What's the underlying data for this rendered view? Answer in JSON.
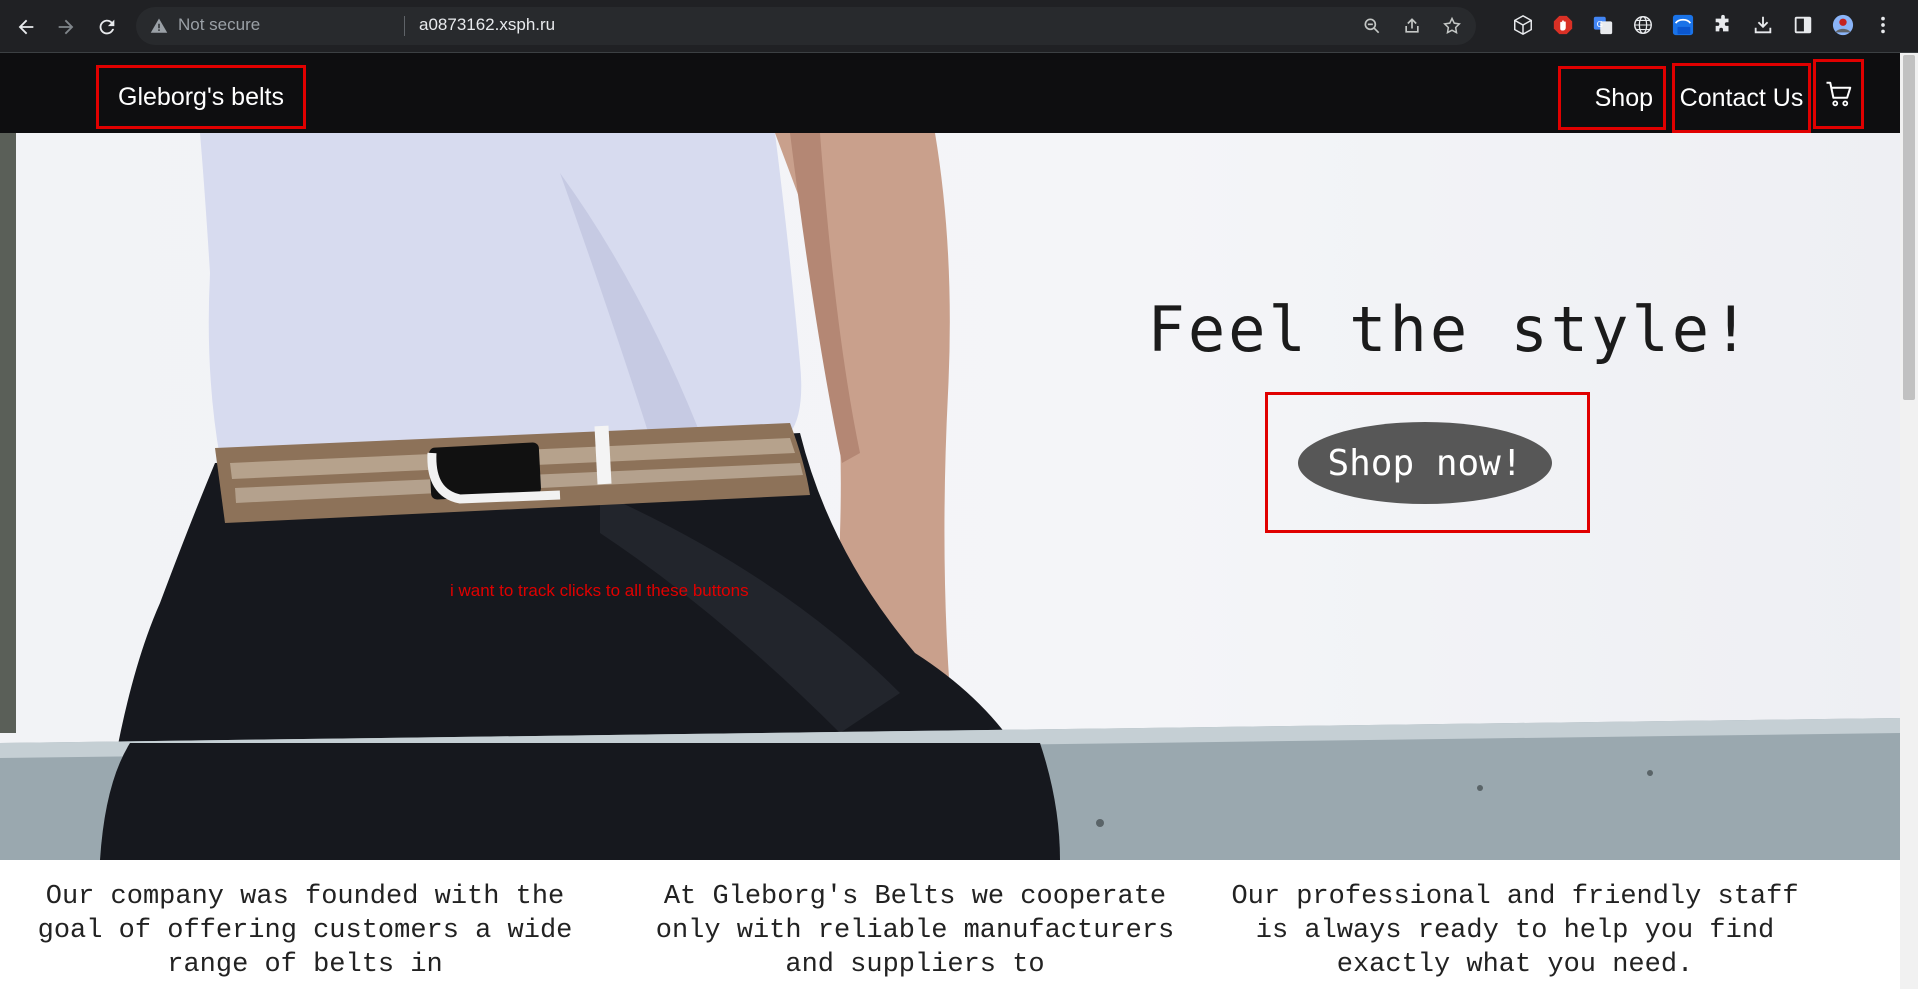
{
  "browser": {
    "security_label": "Not secure",
    "url": "a0873162.xsph.ru"
  },
  "site": {
    "brand": "Gleborg's belts",
    "nav": {
      "shop": "Shop",
      "contact": "Contact Us"
    }
  },
  "hero": {
    "title": "Feel the style!",
    "cta_label": "Shop now!",
    "annotation": "i want to track clicks to all these buttons"
  },
  "about": {
    "col1": "Our company was founded with the goal of offering customers a wide range of belts in",
    "col2": "At Gleborg's Belts we cooperate only with reliable manufacturers and suppliers to",
    "col3": "Our professional and friendly staff is always ready to help you find exactly what you need."
  },
  "colors": {
    "highlight": "#e00000",
    "header_bg": "#0e0e10",
    "cta_bg": "#575757"
  }
}
